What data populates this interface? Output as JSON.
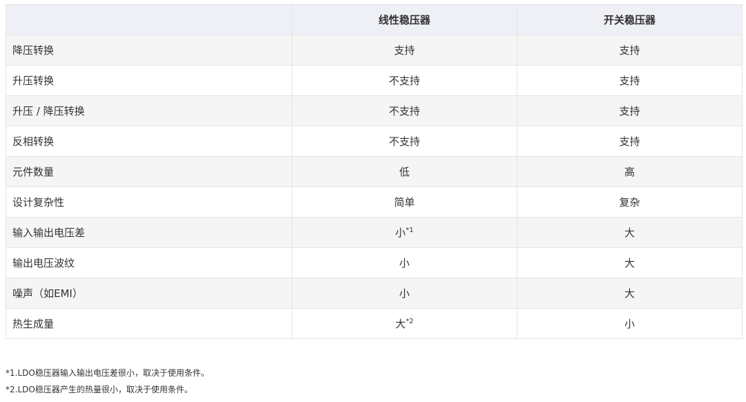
{
  "table": {
    "headers": [
      "",
      "线性稳压器",
      "开关稳压器"
    ],
    "rows": [
      {
        "label": "降压转换",
        "linear": "支持",
        "linear_sup": "",
        "switching": "支持"
      },
      {
        "label": "升压转换",
        "linear": "不支持",
        "linear_sup": "",
        "switching": "支持"
      },
      {
        "label": "升压 / 降压转换",
        "linear": "不支持",
        "linear_sup": "",
        "switching": "支持"
      },
      {
        "label": "反相转换",
        "linear": "不支持",
        "linear_sup": "",
        "switching": "支持"
      },
      {
        "label": "元件数量",
        "linear": "低",
        "linear_sup": "",
        "switching": "高"
      },
      {
        "label": "设计复杂性",
        "linear": "简单",
        "linear_sup": "",
        "switching": "复杂"
      },
      {
        "label": "输入输出电压差",
        "linear": "小",
        "linear_sup": "*1",
        "switching": "大"
      },
      {
        "label": "输出电压波纹",
        "linear": "小",
        "linear_sup": "",
        "switching": "大"
      },
      {
        "label": "噪声（如EMI）",
        "linear": "小",
        "linear_sup": "",
        "switching": "大"
      },
      {
        "label": "热生成量",
        "linear": "大",
        "linear_sup": "*2",
        "switching": "小"
      }
    ]
  },
  "notes": [
    "*1.LDO稳压器输入输出电压差很小，取决于使用条件。",
    "*2.LDO稳压器产生的热量很小，取决于使用条件。"
  ]
}
